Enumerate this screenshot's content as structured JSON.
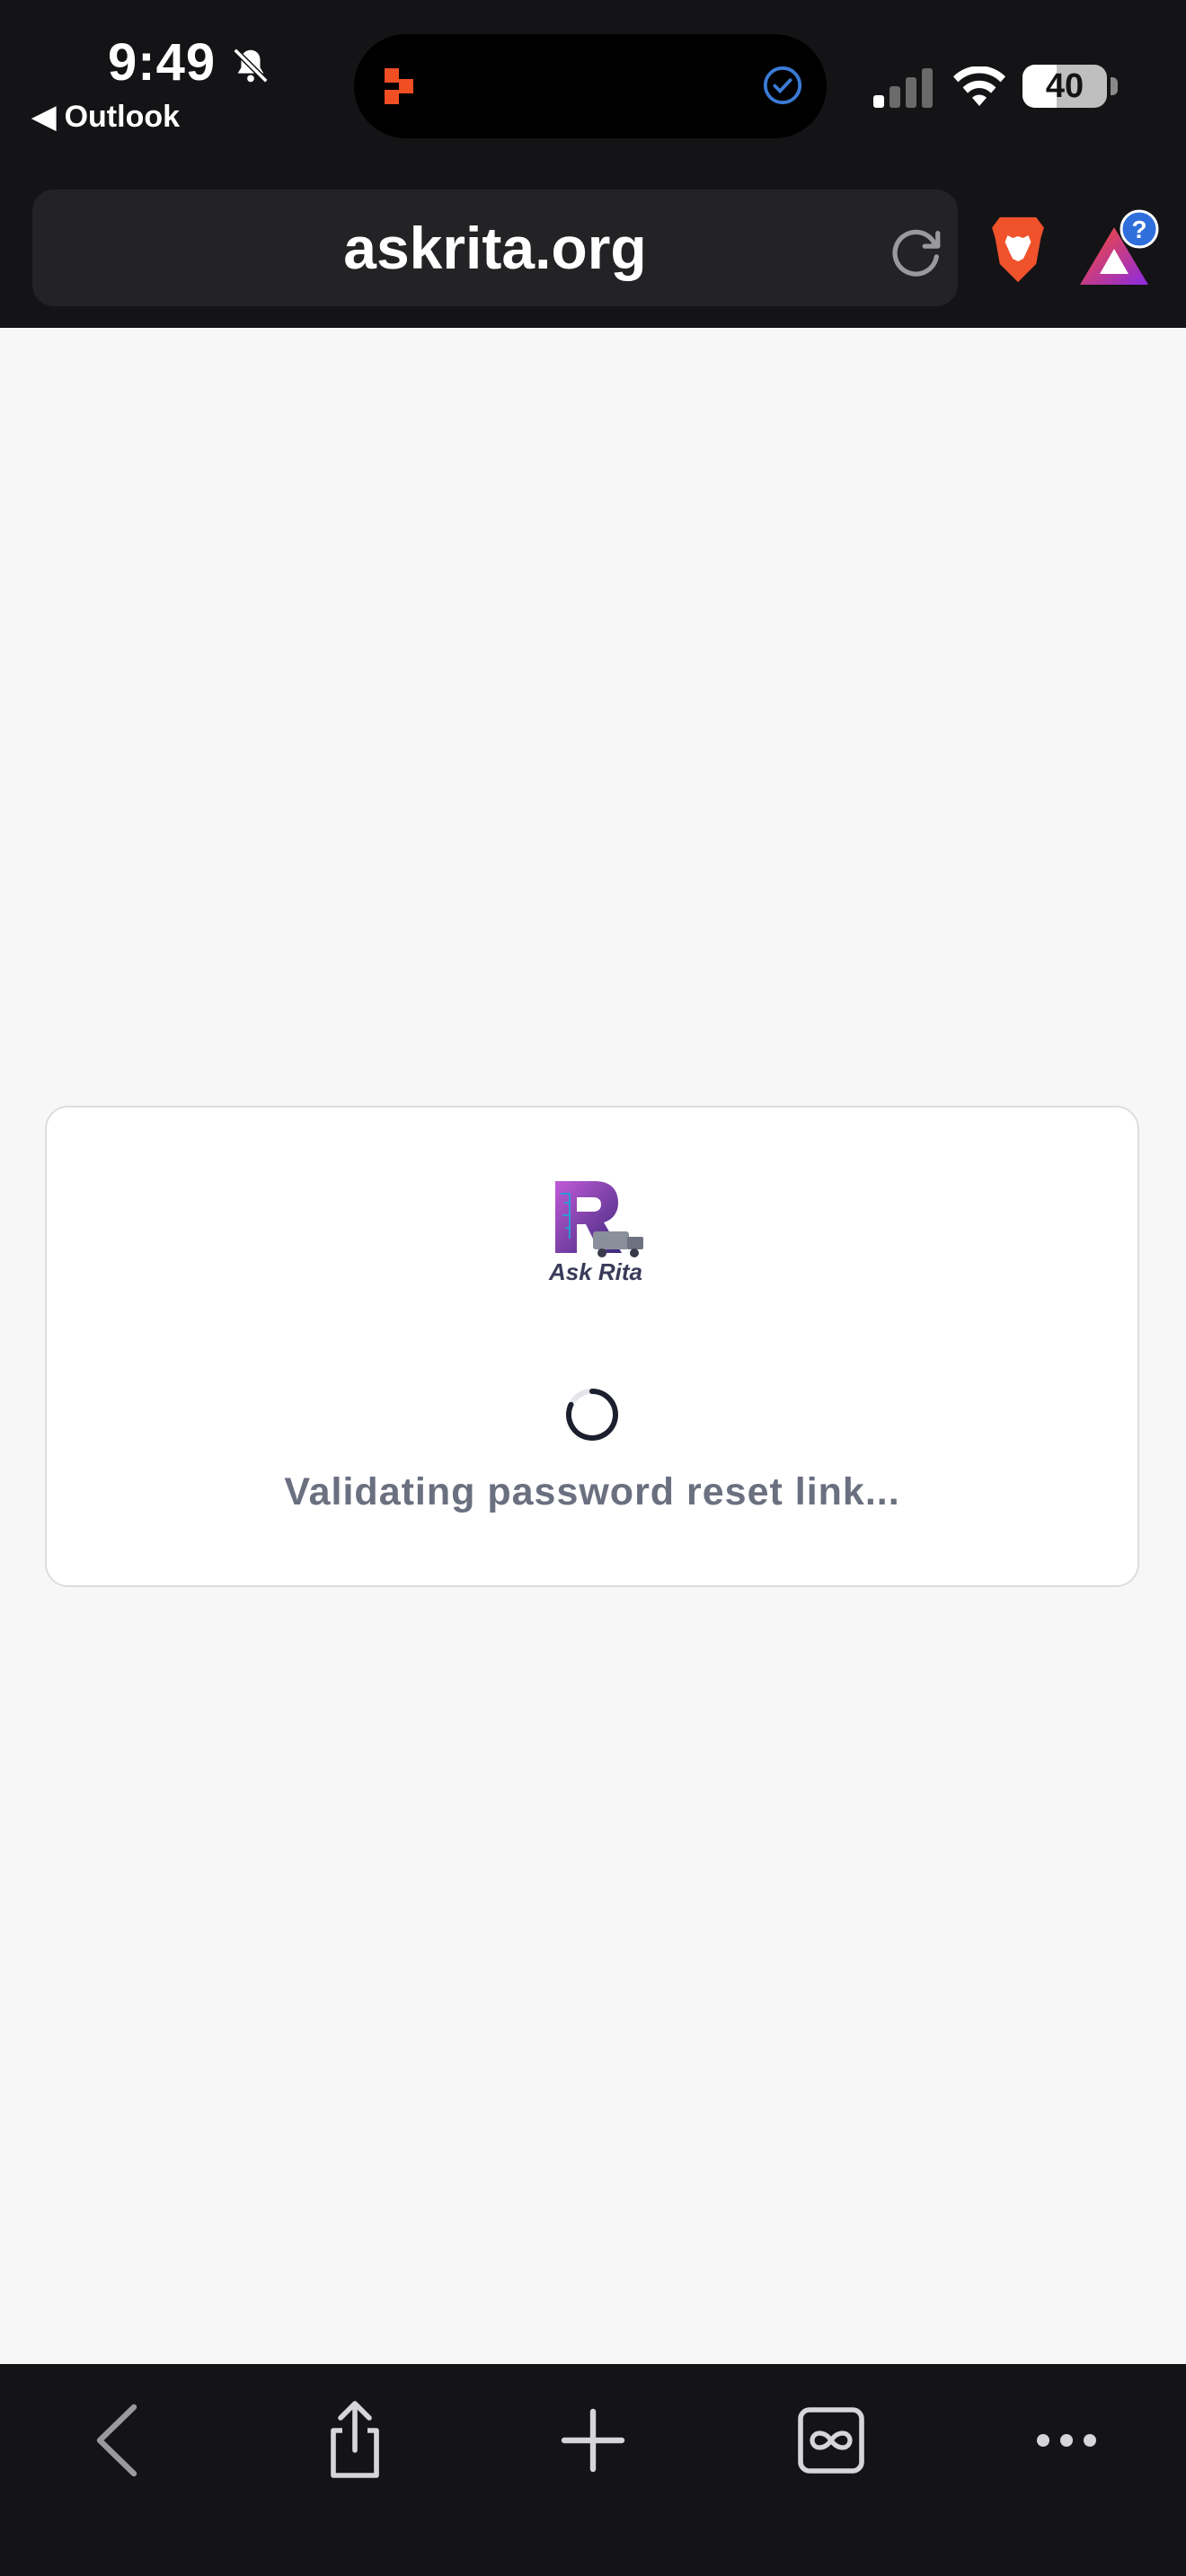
{
  "status_bar": {
    "time": "9:49",
    "back_app": "◀ Outlook",
    "battery": "40",
    "battery_level": 0.4,
    "icons": [
      "bell-slash-icon",
      "app-icon",
      "check-circle-icon",
      "signal-icon",
      "wifi-icon",
      "battery-icon"
    ]
  },
  "browser": {
    "url": "askrita.org",
    "icons": [
      "reload-icon",
      "brave-shields-icon",
      "brave-rewards-icon"
    ],
    "rewards_badge": "?"
  },
  "card": {
    "logo_text": "Ask Rita",
    "message": "Validating password reset link..."
  },
  "toolbar": {
    "icons": [
      "back-icon",
      "share-icon",
      "new-tab-icon",
      "tabs-icon",
      "more-icon"
    ]
  },
  "colors": {
    "chrome_bg": "#141416",
    "page_bg": "#f7f7f8",
    "message": "#6b7080",
    "brave_orange": "#f0522b",
    "accent_blue": "#2f6fdc"
  }
}
